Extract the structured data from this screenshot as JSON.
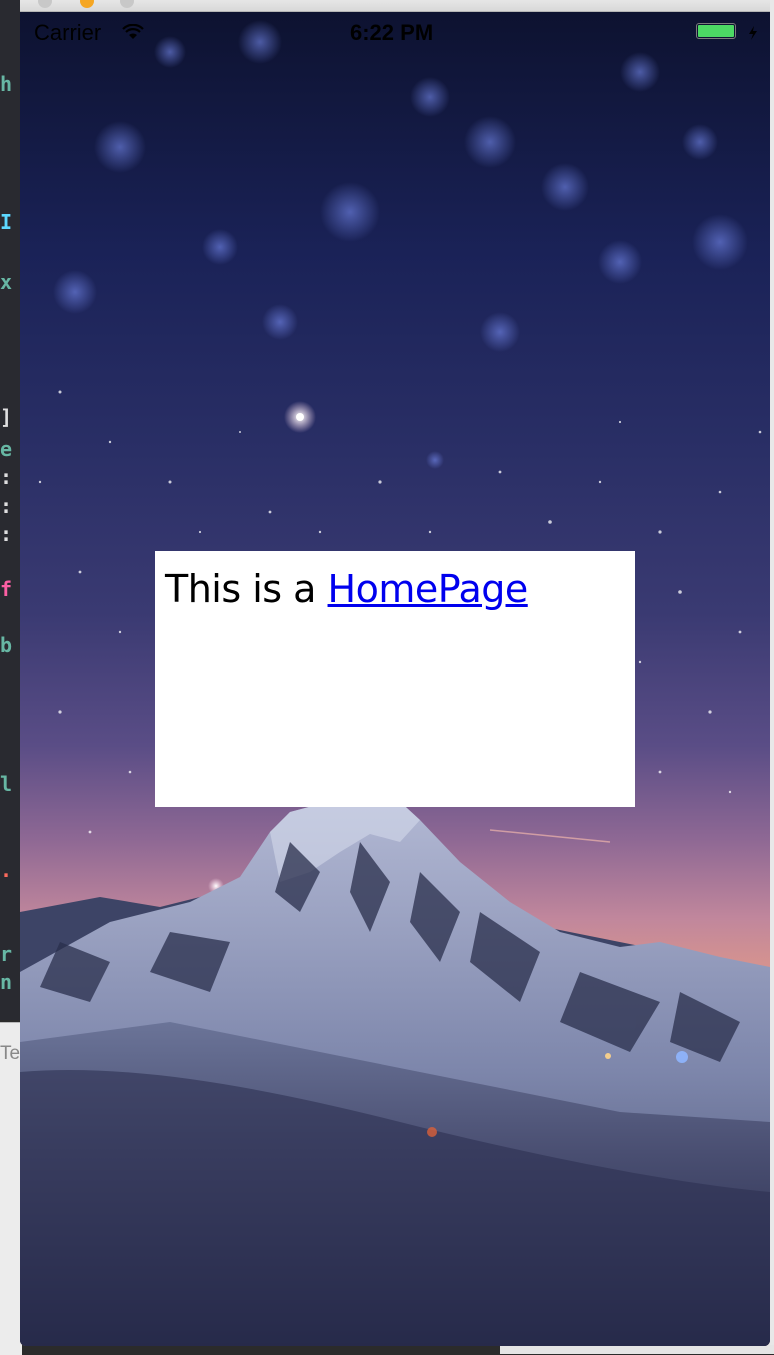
{
  "statusbar": {
    "carrier": "Carrier",
    "time": "6:22 PM",
    "battery_level": 1.0
  },
  "page": {
    "text_prefix": "This is a ",
    "link_label": "HomePage"
  },
  "editor": {
    "bottom_fragment": "Tex"
  },
  "colors": {
    "battery": "#4cd964",
    "link": "#0000ee",
    "card": "#ffffff"
  },
  "icons": [
    "wifi-icon",
    "battery-icon",
    "charging-bolt-icon"
  ]
}
